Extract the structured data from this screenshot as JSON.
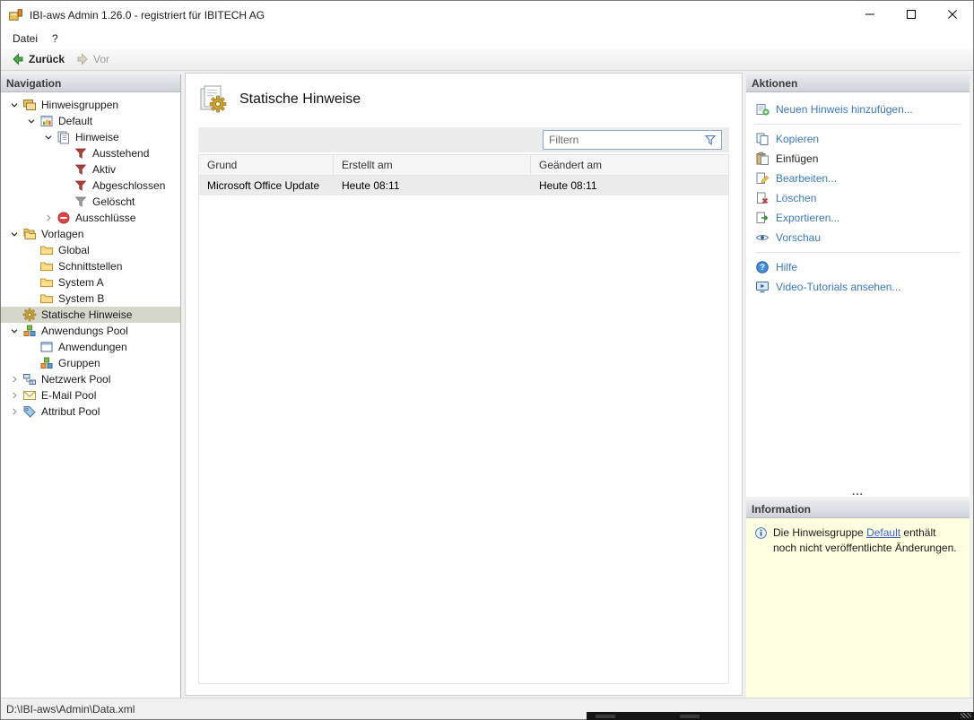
{
  "window": {
    "title": "IBI-aws Admin 1.26.0 - registriert für IBITECH AG"
  },
  "menu": {
    "items": [
      {
        "label": "Datei"
      },
      {
        "label": "?"
      }
    ]
  },
  "toolbar": {
    "back": "Zurück",
    "forward": "Vor"
  },
  "navigation": {
    "header": "Navigation",
    "tree": [
      {
        "label": "Hinweisgruppen",
        "icon": "hint-groups-icon",
        "level": 0,
        "state": "expanded"
      },
      {
        "label": "Default",
        "icon": "hint-group-icon",
        "level": 1,
        "state": "expanded"
      },
      {
        "label": "Hinweise",
        "icon": "hints-icon",
        "level": 2,
        "state": "expanded"
      },
      {
        "label": "Ausstehend",
        "icon": "filter-pending-icon",
        "level": 3,
        "state": "none"
      },
      {
        "label": "Aktiv",
        "icon": "filter-active-icon",
        "level": 3,
        "state": "none"
      },
      {
        "label": "Abgeschlossen",
        "icon": "filter-done-icon",
        "level": 3,
        "state": "none"
      },
      {
        "label": "Gelöscht",
        "icon": "filter-deleted-icon",
        "level": 3,
        "state": "none"
      },
      {
        "label": "Ausschlüsse",
        "icon": "no-entry-icon",
        "level": 2,
        "state": "collapsed"
      },
      {
        "label": "Vorlagen",
        "icon": "templates-icon",
        "level": 0,
        "state": "expanded"
      },
      {
        "label": "Global",
        "icon": "folder-icon",
        "level": 1,
        "state": "none"
      },
      {
        "label": "Schnittstellen",
        "icon": "folder-icon",
        "level": 1,
        "state": "none"
      },
      {
        "label": "System A",
        "icon": "folder-icon",
        "level": 1,
        "state": "none"
      },
      {
        "label": "System B",
        "icon": "folder-icon",
        "level": 1,
        "state": "none"
      },
      {
        "label": "Statische Hinweise",
        "icon": "gear-icon",
        "level": 0,
        "state": "none",
        "selected": true
      },
      {
        "label": "Anwendungs Pool",
        "icon": "app-pool-icon",
        "level": 0,
        "state": "expanded"
      },
      {
        "label": "Anwendungen",
        "icon": "window-icon",
        "level": 1,
        "state": "none"
      },
      {
        "label": "Gruppen",
        "icon": "cubes-icon",
        "level": 1,
        "state": "none"
      },
      {
        "label": "Netzwerk Pool",
        "icon": "network-icon",
        "level": 0,
        "state": "collapsed"
      },
      {
        "label": "E-Mail Pool",
        "icon": "email-icon",
        "level": 0,
        "state": "collapsed"
      },
      {
        "label": "Attribut Pool",
        "icon": "attribute-icon",
        "level": 0,
        "state": "collapsed"
      }
    ]
  },
  "main": {
    "title": "Statische Hinweise",
    "filter_placeholder": "Filtern",
    "table": {
      "columns": [
        "Grund",
        "Erstellt am",
        "Geändert am"
      ],
      "rows": [
        {
          "cells": [
            "Microsoft Office Update",
            "Heute 08:11",
            "Heute 08:11"
          ]
        }
      ]
    }
  },
  "actions": {
    "header": "Aktionen",
    "groups": [
      {
        "items": [
          {
            "label": "Neuen Hinweis hinzufügen...",
            "icon": "add-hint-icon"
          }
        ]
      },
      {
        "items": [
          {
            "label": "Kopieren",
            "icon": "copy-icon"
          },
          {
            "label": "Einfügen",
            "icon": "paste-icon",
            "disabled": true
          },
          {
            "label": "Bearbeiten...",
            "icon": "edit-icon"
          },
          {
            "label": "Löschen",
            "icon": "delete-icon"
          },
          {
            "label": "Exportieren...",
            "icon": "export-icon"
          },
          {
            "label": "Vorschau",
            "icon": "preview-icon"
          }
        ]
      },
      {
        "items": [
          {
            "label": "Hilfe",
            "icon": "help-icon"
          },
          {
            "label": "Video-Tutorials ansehen...",
            "icon": "video-icon"
          }
        ]
      }
    ],
    "overflow": "..."
  },
  "information": {
    "header": "Information",
    "text_before": "Die Hinweisgruppe ",
    "link_text": "Default",
    "text_after": " enthält noch nicht veröffentlichte Änderungen."
  },
  "statusbar": {
    "path": "D:\\IBI-aws\\Admin\\Data.xml"
  },
  "colors": {
    "action_link": "#3a78c3",
    "selection": "#d5d7cb",
    "info_background": "#ffffe1"
  }
}
